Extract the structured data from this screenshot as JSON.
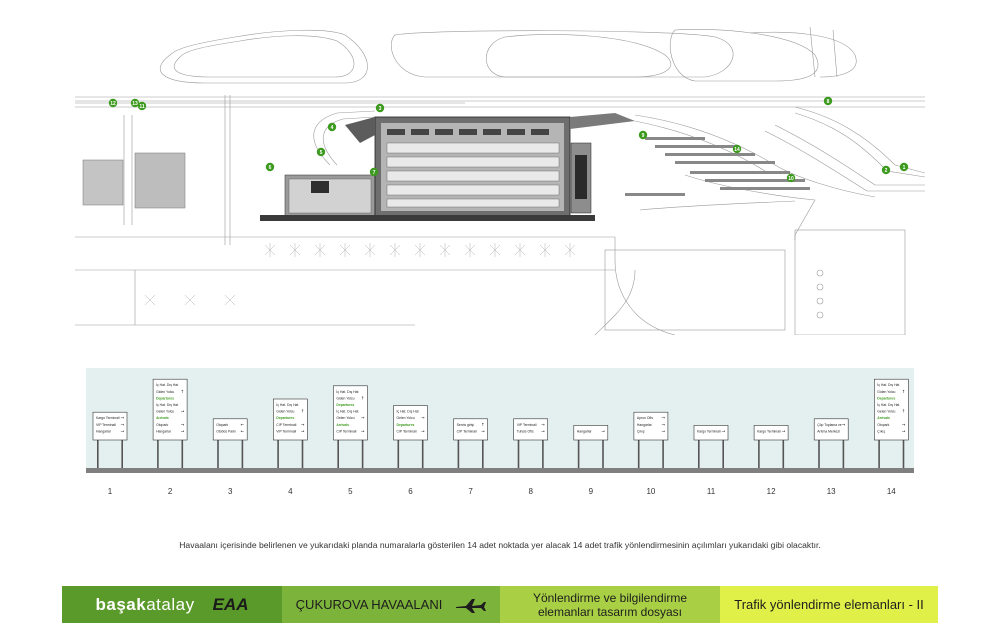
{
  "plan": {
    "markers": [
      "1",
      "2",
      "3",
      "4",
      "5",
      "6",
      "7",
      "8",
      "9",
      "10",
      "11",
      "12",
      "13",
      "14"
    ]
  },
  "signs": [
    {
      "number": "1",
      "lines": [
        {
          "t": "Kargo Terminali",
          "a": "→"
        },
        {
          "t": "VIP Terminali",
          "a": "→"
        },
        {
          "t": "Hangarlar",
          "a": "→"
        }
      ]
    },
    {
      "number": "2",
      "lines": [
        {
          "t": "İç Hat. Dış Hat",
          "a": ""
        },
        {
          "t": "Giden Yolcu",
          "a": "↑"
        },
        {
          "t": "Departures",
          "a": "",
          "g": true
        },
        {
          "t": "İç Hat. Dış Hat",
          "a": ""
        },
        {
          "t": "Gelen Yolcu",
          "a": "→"
        },
        {
          "t": "Arrivals",
          "a": "",
          "g": true
        },
        {
          "t": "Otopark",
          "a": "→"
        },
        {
          "t": "Hangarlar",
          "a": "→"
        }
      ]
    },
    {
      "number": "3",
      "lines": [
        {
          "t": "Otopark",
          "a": "←"
        },
        {
          "t": "Otobüs Parkı",
          "a": "←"
        }
      ]
    },
    {
      "number": "4",
      "lines": [
        {
          "t": "İç Hat. Dış Hat",
          "a": ""
        },
        {
          "t": "Giden Yolcu",
          "a": "↑"
        },
        {
          "t": "Departures",
          "a": "",
          "g": true
        },
        {
          "t": "CIP Terminali",
          "a": "→"
        },
        {
          "t": "VIP Terminali",
          "a": "→"
        }
      ]
    },
    {
      "number": "5",
      "lines": [
        {
          "t": "İç Hat. Dış Hat",
          "a": ""
        },
        {
          "t": "Giden Yolcu",
          "a": "↑"
        },
        {
          "t": "Departures",
          "a": "",
          "g": true
        },
        {
          "t": "İç Hat. Dış Hat",
          "a": ""
        },
        {
          "t": "Gelen Yolcu",
          "a": "→"
        },
        {
          "t": "Arrivals",
          "a": "",
          "g": true
        },
        {
          "t": "CIP Terminali",
          "a": "→"
        }
      ]
    },
    {
      "number": "6",
      "lines": [
        {
          "t": "İç Hat. Dış Hat",
          "a": ""
        },
        {
          "t": "Gelen Yolcu",
          "a": "→"
        },
        {
          "t": "Departures",
          "a": "",
          "g": true
        },
        {
          "t": "CIP Terminali",
          "a": "→"
        }
      ]
    },
    {
      "number": "7",
      "lines": [
        {
          "t": "Servis girişi",
          "a": "↑"
        },
        {
          "t": "CIP Terminali",
          "a": "→"
        }
      ]
    },
    {
      "number": "8",
      "lines": [
        {
          "t": "VIP Terminali",
          "a": "→"
        },
        {
          "t": "Tuhsis Ofis",
          "a": "→"
        }
      ]
    },
    {
      "number": "9",
      "lines": [
        {
          "t": "Hangarlar",
          "a": "→"
        }
      ]
    },
    {
      "number": "10",
      "lines": [
        {
          "t": "Apron Ofis",
          "a": "→"
        },
        {
          "t": "Hangarlar",
          "a": "→"
        },
        {
          "t": "Çıkış",
          "a": "→"
        }
      ]
    },
    {
      "number": "11",
      "lines": [
        {
          "t": "Kargo Terminali",
          "a": "→"
        }
      ]
    },
    {
      "number": "12",
      "lines": [
        {
          "t": "Kargo Terminali",
          "a": "→"
        }
      ]
    },
    {
      "number": "13",
      "lines": [
        {
          "t": "Çöp Toplama ve",
          "a": "→"
        },
        {
          "t": "Arıtma Merkezi",
          "a": ""
        }
      ]
    },
    {
      "number": "14",
      "lines": [
        {
          "t": "İç Hat. Dış Hat",
          "a": ""
        },
        {
          "t": "Giden Yolcu",
          "a": "↑"
        },
        {
          "t": "Departures",
          "a": "",
          "g": true
        },
        {
          "t": "İç Hat. Dış Hat",
          "a": ""
        },
        {
          "t": "Gelen Yolcu",
          "a": "↑"
        },
        {
          "t": "Arrivals",
          "a": "",
          "g": true
        },
        {
          "t": "Otopark",
          "a": "→"
        },
        {
          "t": "Çıkış",
          "a": "→"
        }
      ]
    }
  ],
  "caption": "Havaalanı içerisinde belirlenen ve yukarıdaki planda numaralarla gösterilen 14 adet noktada yer alacak 14 adet trafik yönlendirmesinin açılımları yukarıdaki gibi olacaktır.",
  "banner": {
    "logo_part1": "başak",
    "logo_part2": "atalay",
    "logo_eaa": "EAA",
    "airport": "ÇUKUROVA HAVAALANI",
    "doc_title": "Yönlendirme ve bilgilendirme\nelemanları tasarım dosyası",
    "section": "Trafik yönlendirme elemanları - II"
  },
  "colors": {
    "strip_bg": "#e4f0ef",
    "ground": "#7f7f7f",
    "green": "#3c9a1e",
    "b1": "#5a9a2a",
    "b2": "#7cb33a",
    "b3": "#a9d045",
    "b4": "#e0f048"
  }
}
